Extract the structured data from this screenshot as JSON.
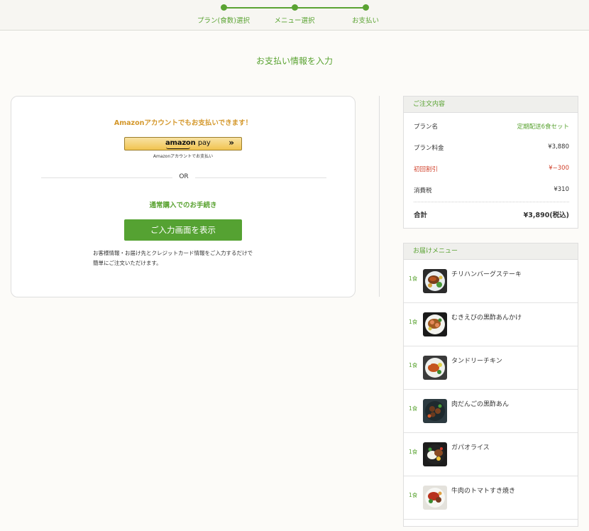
{
  "stepper": {
    "steps": [
      {
        "label": "プラン(食数)選択"
      },
      {
        "label": "メニュー選択"
      },
      {
        "label": "お支払い"
      }
    ],
    "accent": "#5aa332"
  },
  "page_title": "お支払い情報を入力",
  "payment": {
    "amazon_text": "Amazonアカウントでもお支払いできます！",
    "amazon_button": {
      "brand": "amazon",
      "pay": "pay",
      "arrow": "»"
    },
    "amazon_sub": "Amazonアカウントでお支払い",
    "or": "OR",
    "normal_text": "通常購入でのお手続き",
    "show_button": "ご入力画面を表示",
    "desc_line1": "お客様情報・お届け先とクレジットカード情報をご入力するだけで",
    "desc_line2": "簡単にご注文いただけます。"
  },
  "order": {
    "title": "ご注文内容",
    "rows": [
      {
        "label": "プラン名",
        "value": "定期配送6食セット"
      },
      {
        "label": "プラン料金",
        "value": "¥3,880"
      },
      {
        "label": "初回割引",
        "value": "¥−300"
      },
      {
        "label": "消費税",
        "value": "¥310"
      }
    ],
    "total_label": "合計",
    "total_value": "¥3,890(税込)"
  },
  "menu": {
    "title": "お届けメニュー",
    "items": [
      {
        "qty": "1食",
        "name": "チリハンバーグステーキ",
        "icon": "dish-photo"
      },
      {
        "qty": "1食",
        "name": "むきえびの黒酢あんかけ",
        "icon": "dish-photo"
      },
      {
        "qty": "1食",
        "name": "タンドリーチキン",
        "icon": "dish-photo"
      },
      {
        "qty": "1食",
        "name": "肉だんごの黒酢あん",
        "icon": "dish-photo"
      },
      {
        "qty": "1食",
        "name": "ガパオライス",
        "icon": "dish-photo"
      },
      {
        "qty": "1食",
        "name": "牛肉のトマトすき焼き",
        "icon": "dish-photo"
      }
    ]
  }
}
